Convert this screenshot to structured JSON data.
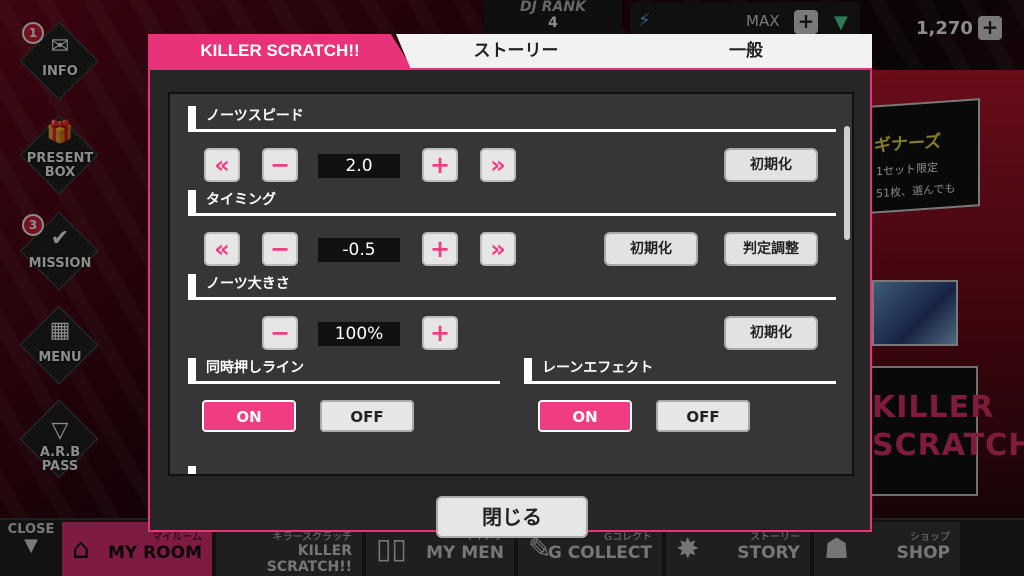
{
  "header": {
    "dj_rank_label": "DJ RANK",
    "dj_rank_value": "4",
    "stamina_max_label": "MAX",
    "coins": "1,270"
  },
  "left_menu": [
    {
      "label": "INFO",
      "badge": "1"
    },
    {
      "label": "PRESENT\nBOX",
      "badge": ""
    },
    {
      "label": "MISSION",
      "badge": "3"
    },
    {
      "label": "MENU",
      "badge": ""
    },
    {
      "label": "A.R.B\nPASS",
      "badge": ""
    }
  ],
  "bottom_nav": {
    "close_label": "CLOSE",
    "items": [
      {
        "sub": "マイルーム",
        "label": "MY ROOM",
        "active": true
      },
      {
        "sub": "キラースクラッチ",
        "label": "KILLER SCRATCH!!",
        "active": false
      },
      {
        "sub": "マイメン",
        "label": "MY MEN",
        "active": false
      },
      {
        "sub": "Gコレクト",
        "label": "G COLLECT",
        "active": false
      },
      {
        "sub": "ストーリー",
        "label": "STORY",
        "active": false
      },
      {
        "sub": "ショップ",
        "label": "SHOP",
        "active": false
      }
    ]
  },
  "background_banners": {
    "banner1_text": "ギナーズ",
    "banner1_line2": "1セット限定",
    "banner1_line3": "51枚、選んでも",
    "killer_line1": "KILLER",
    "killer_line2": "SCRATCH!!"
  },
  "modal": {
    "tabs": {
      "killer": "KILLER SCRATCH!!",
      "story": "ストーリー",
      "general": "一般"
    },
    "note_speed": {
      "label": "ノーツスピード",
      "value": "2.0",
      "reset": "初期化"
    },
    "timing": {
      "label": "タイミング",
      "value": "-0.5",
      "reset": "初期化",
      "adjust": "判定調整"
    },
    "note_size": {
      "label": "ノーツ大きさ",
      "value": "100%",
      "reset": "初期化"
    },
    "simul_line": {
      "label": "同時押しライン",
      "on": "ON",
      "off": "OFF",
      "selected": "ON"
    },
    "lane_effect": {
      "label": "レーンエフェクト",
      "on": "ON",
      "off": "OFF",
      "selected": "ON"
    },
    "close": "閉じる"
  },
  "colors": {
    "accent": "#e8327a",
    "panel": "#363636",
    "frame": "#262626"
  }
}
